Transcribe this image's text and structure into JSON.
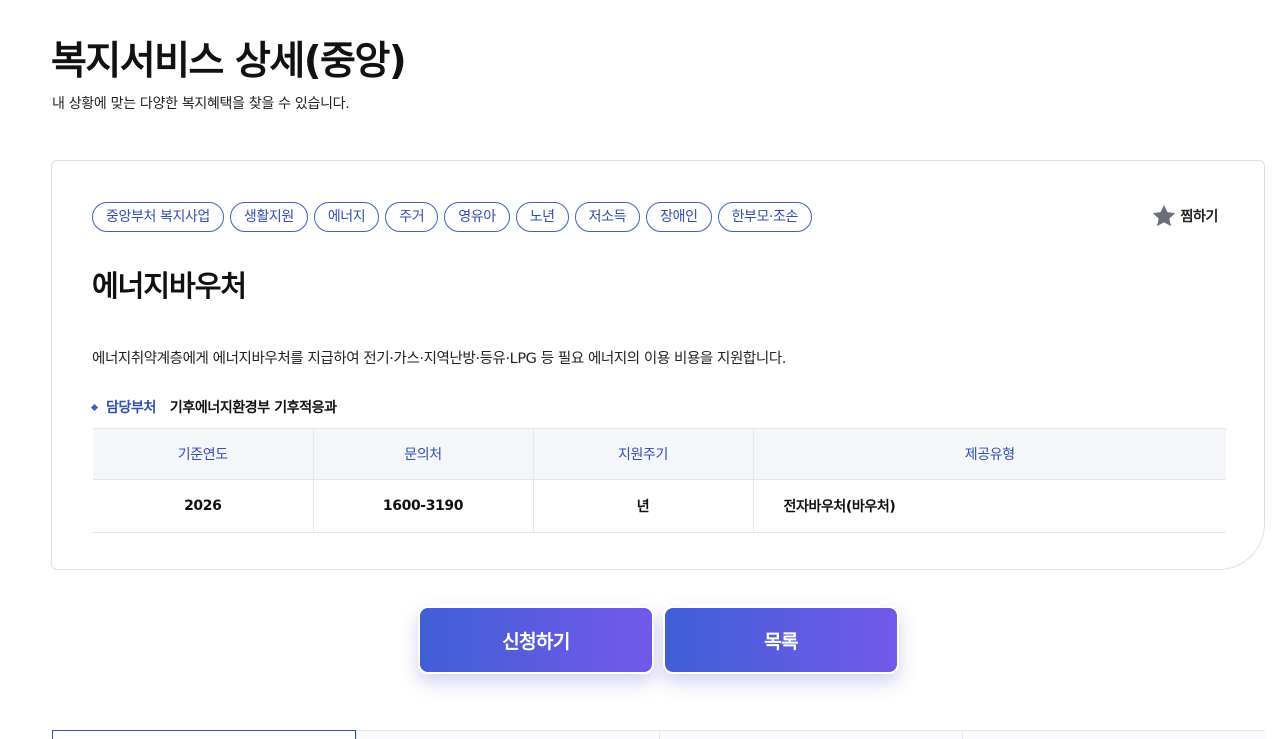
{
  "header": {
    "title": "복지서비스 상세(중앙)",
    "subtitle": "내 상황에 맞는 다양한 복지혜택을 찾을 수 있습니다."
  },
  "tags": [
    "중앙부처 복지사업",
    "생활지원",
    "에너지",
    "주거",
    "영유아",
    "노년",
    "저소득",
    "장애인",
    "한부모·조손"
  ],
  "bookmark": {
    "label": "찜하기",
    "icon": "star-icon"
  },
  "service": {
    "title": "에너지바우처",
    "description": "에너지취약계층에게 에너지바우처를 지급하여 전기·가스·지역난방·등유·LPG 등 필요 에너지의 이용 비용을 지원합니다.",
    "dept_label": "담당부처",
    "dept_value": "기후에너지환경부 기후적응과"
  },
  "table": {
    "headers": [
      "기준연도",
      "문의처",
      "지원주기",
      "제공유형"
    ],
    "row": [
      "2026",
      "1600-3190",
      "년",
      "전자바우처(바우처)"
    ]
  },
  "actions": {
    "apply_label": "신청하기",
    "list_label": "목록"
  },
  "colors": {
    "accent": "#2f4fb4",
    "button_gradient_start": "#3f5fd6",
    "button_gradient_end": "#7459ea"
  }
}
